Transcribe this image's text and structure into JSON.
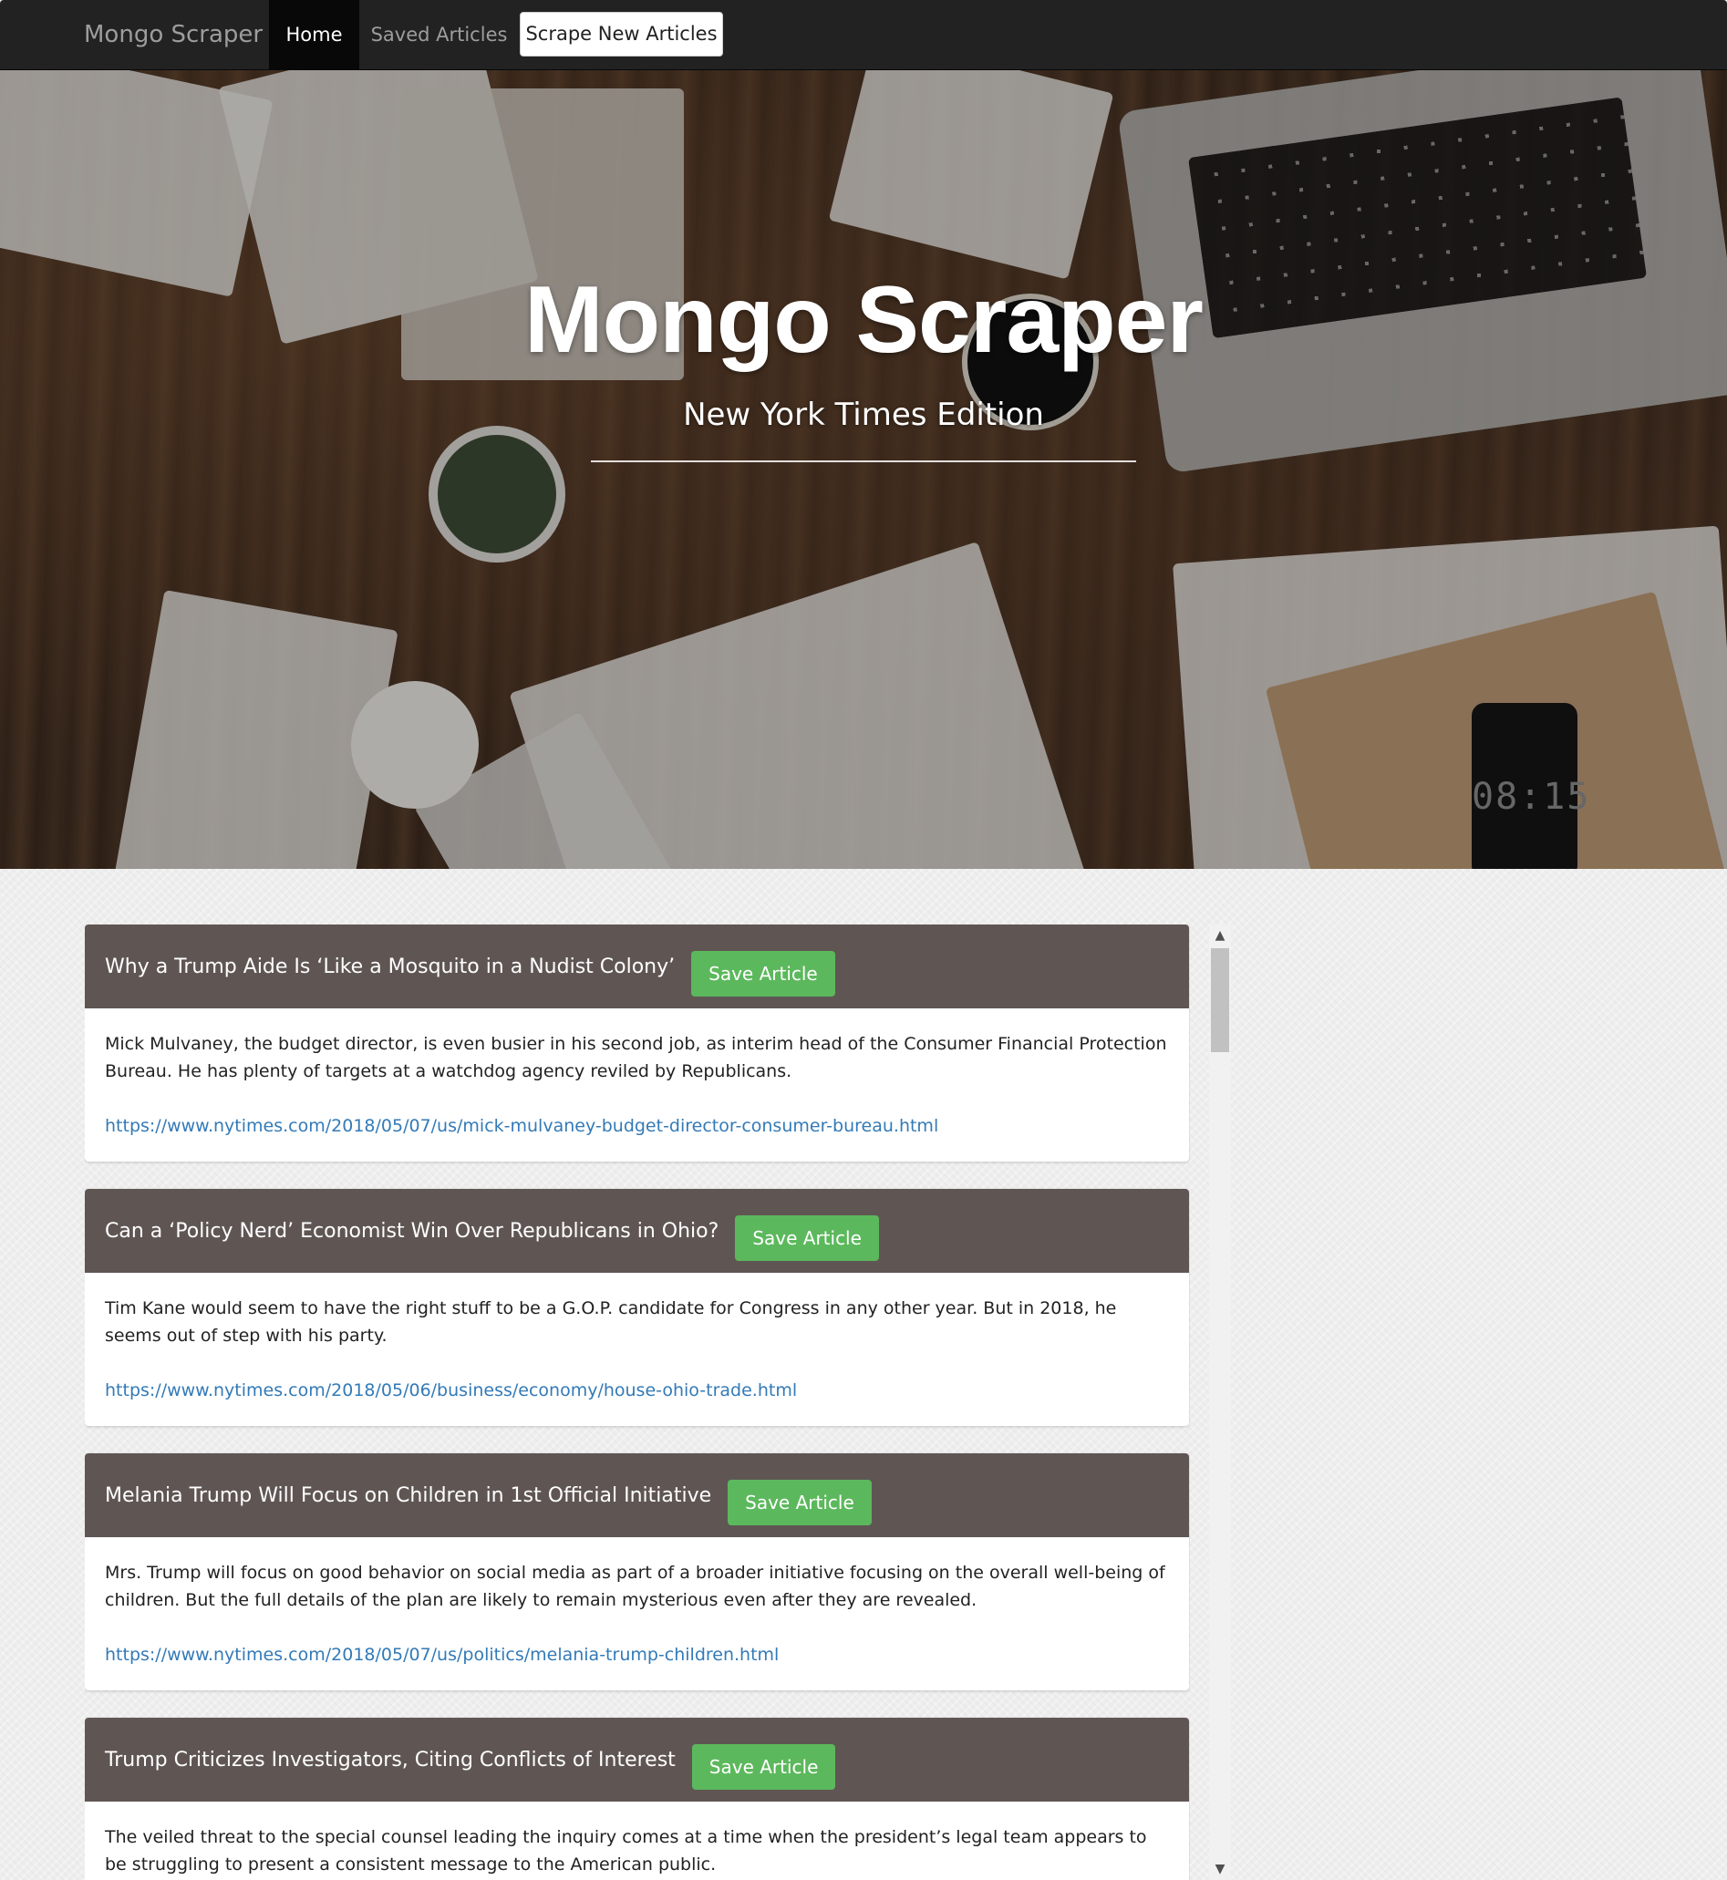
{
  "navbar": {
    "brand": "Mongo Scraper",
    "items": [
      {
        "label": "Home"
      },
      {
        "label": "Saved Articles"
      },
      {
        "label": "Scrape New Articles"
      }
    ]
  },
  "hero": {
    "title": "Mongo Scraper",
    "subtitle": "New York Times Edition",
    "phone_time": "08:15"
  },
  "articles": [
    {
      "title": "Why a Trump Aide Is ‘Like a Mosquito in a Nudist Colony’",
      "save_label": "Save Article",
      "summary": "Mick Mulvaney, the budget director, is even busier in his second job, as interim head of the Consumer Financial Protection Bureau. He has plenty of targets at a watchdog agency reviled by Republicans.",
      "url": "https://www.nytimes.com/2018/05/07/us/mick-mulvaney-budget-director-consumer-bureau.html"
    },
    {
      "title": "Can a ‘Policy Nerd’ Economist Win Over Republicans in Ohio?",
      "save_label": "Save Article",
      "summary": "Tim Kane would seem to have the right stuff to be a G.O.P. candidate for Congress in any other year. But in 2018, he seems out of step with his party.",
      "url": "https://www.nytimes.com/2018/05/06/business/economy/house-ohio-trade.html"
    },
    {
      "title": "Melania Trump Will Focus on Children in 1st Official Initiative",
      "save_label": "Save Article",
      "summary": "Mrs. Trump will focus on good behavior on social media as part of a broader initiative focusing on the overall well-being of children. But the full details of the plan are likely to remain mysterious even after they are revealed.",
      "url": "https://www.nytimes.com/2018/05/07/us/politics/melania-trump-children.html"
    },
    {
      "title": "Trump Criticizes Investigators, Citing Conflicts of Interest",
      "save_label": "Save Article",
      "summary": "The veiled threat to the special counsel leading the inquiry comes at a time when the president’s legal team appears to be struggling to present a consistent message to the American public.",
      "url": ""
    }
  ],
  "colors": {
    "navbar_bg": "#222222",
    "panel_heading_bg": "#5f5654",
    "save_button_bg": "#5cb85c",
    "link_color": "#337ab7"
  }
}
